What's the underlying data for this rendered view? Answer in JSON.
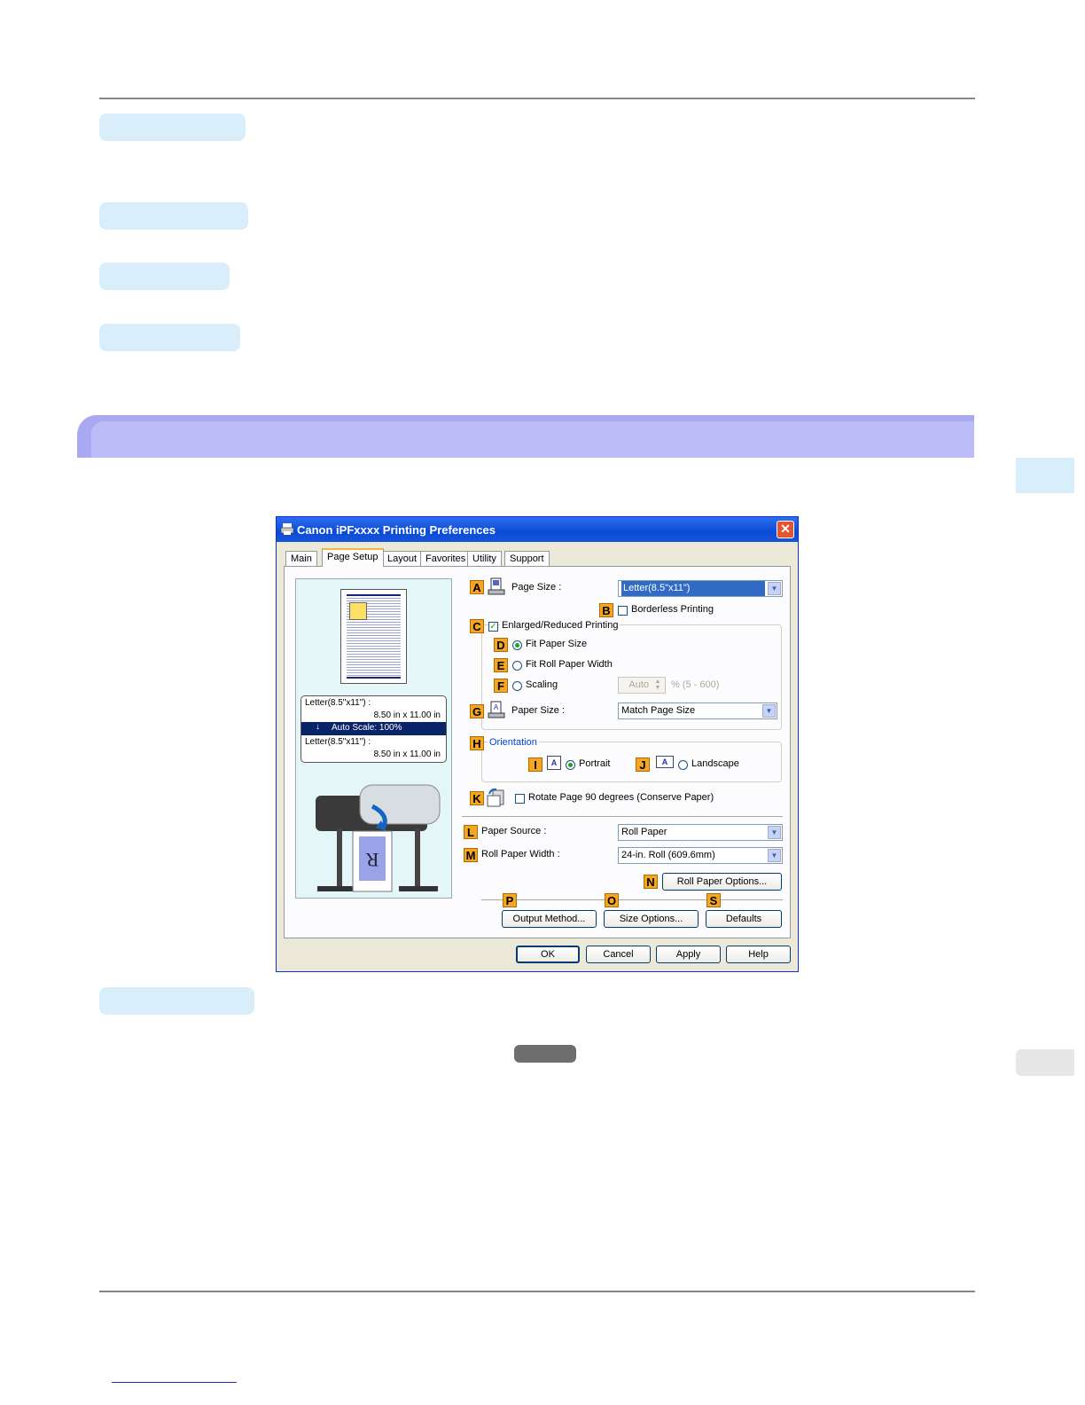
{
  "dialog": {
    "title": "Canon iPFxxxx Printing Preferences",
    "close_label": "✕",
    "tabs": [
      "Main",
      "Page Setup",
      "Layout",
      "Favorites",
      "Utility",
      "Support"
    ],
    "active_tab": "Page Setup",
    "preview": {
      "line1": "Letter(8.5\"x11\") :",
      "line2": "8.50 in x 11.00 in",
      "scale": "Auto Scale: 100%",
      "line3": "Letter(8.5\"x11\") :",
      "line4": "8.50 in x 11.00 in",
      "printer_letter": "R"
    },
    "badges": {
      "A": "A",
      "B": "B",
      "C": "C",
      "D": "D",
      "E": "E",
      "F": "F",
      "G": "G",
      "H": "H",
      "I": "I",
      "J": "J",
      "K": "K",
      "L": "L",
      "M": "M",
      "N": "N",
      "O": "O",
      "P": "P",
      "S": "S"
    },
    "page_size": {
      "label": "Page Size :",
      "value": "Letter(8.5\"x11\")"
    },
    "borderless": {
      "label": "Borderless Printing",
      "checked": false
    },
    "enlarged": {
      "label": "Enlarged/Reduced Printing",
      "checked": true
    },
    "fit_paper_size": "Fit Paper Size",
    "fit_roll_width": "Fit Roll Paper Width",
    "scaling": {
      "label": "Scaling",
      "value": "Auto",
      "range": "% (5 - 600)"
    },
    "paper_size": {
      "label": "Paper Size :",
      "value": "Match Page Size"
    },
    "orientation": {
      "title": "Orientation",
      "portrait": "Portrait",
      "landscape": "Landscape",
      "icon_letter": "A"
    },
    "rotate": {
      "label": "Rotate Page 90 degrees (Conserve Paper)",
      "checked": false
    },
    "paper_source": {
      "label": "Paper Source :",
      "value": "Roll Paper"
    },
    "roll_width": {
      "label": "Roll Paper Width :",
      "value": "24-in. Roll (609.6mm)"
    },
    "buttons": {
      "roll_options": "Roll Paper Options...",
      "output_method": "Output Method...",
      "size_options": "Size Options...",
      "defaults": "Defaults",
      "ok": "OK",
      "cancel": "Cancel",
      "apply": "Apply",
      "help": "Help"
    }
  }
}
